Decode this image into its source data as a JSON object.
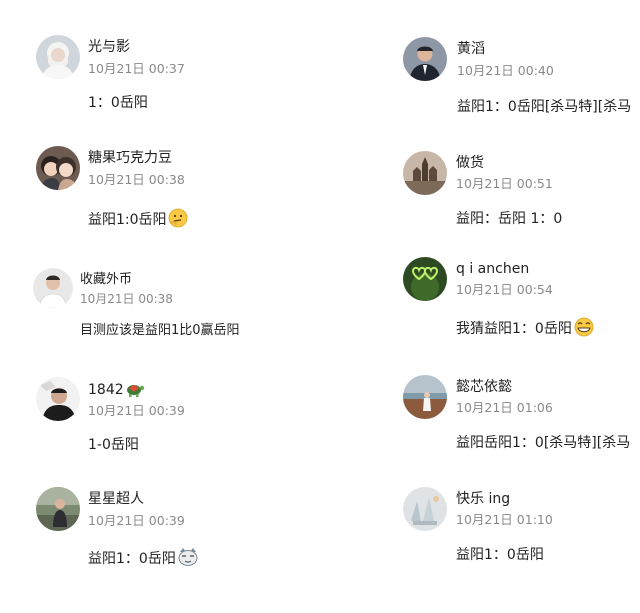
{
  "left_column": [
    {
      "username": "光与影",
      "timestamp": "10月21日 00:37",
      "content": "1：0岳阳",
      "avatar": "avatar-white-hair-person-icon"
    },
    {
      "username": "糖果巧克力豆",
      "timestamp": "10月21日 00:38",
      "content": "益阳1:0岳阳",
      "emoji": "thinking-emoji-icon",
      "avatar": "avatar-cartoon-couple-icon"
    },
    {
      "username": "收藏外币",
      "timestamp": "10月21日 00:38",
      "content": "目测应该是益阳1比0赢岳阳",
      "avatar": "avatar-man-portrait-icon"
    },
    {
      "username": "1842",
      "username_badge": "turtle-icon",
      "timestamp": "10月21日 00:39",
      "content": "1-0岳阳",
      "avatar": "avatar-man-dark-shirt-icon"
    },
    {
      "username": "星星超人",
      "timestamp": "10月21日 00:39",
      "content": "益阳1：0岳阳",
      "emoji": "cat-face-emoji-icon",
      "avatar": "avatar-outdoor-person-icon"
    }
  ],
  "right_column": [
    {
      "username": "黄滔",
      "timestamp": "10月21日 00:40",
      "content": "益阳1：0岳阳[杀马特][杀马",
      "avatar": "avatar-man-suit-icon"
    },
    {
      "username": "做货",
      "timestamp": "10月21日 00:51",
      "content": "益阳：岳阳 1：0",
      "avatar": "avatar-castle-landscape-icon"
    },
    {
      "username": "q i anchen",
      "timestamp": "10月21日 00:54",
      "content": "我猜益阳1：0岳阳",
      "emoji": "grinning-emoji-icon",
      "avatar": "avatar-green-hearts-icon"
    },
    {
      "username": "懿芯依懿",
      "timestamp": "10月21日 01:06",
      "content": "益阳岳阳1：0[杀马特][杀马",
      "avatar": "avatar-lakeside-person-icon"
    },
    {
      "username": "快乐 ing",
      "timestamp": "10月21日 01:10",
      "content": "益阳1：0岳阳",
      "avatar": "avatar-pale-sketch-icon"
    }
  ]
}
